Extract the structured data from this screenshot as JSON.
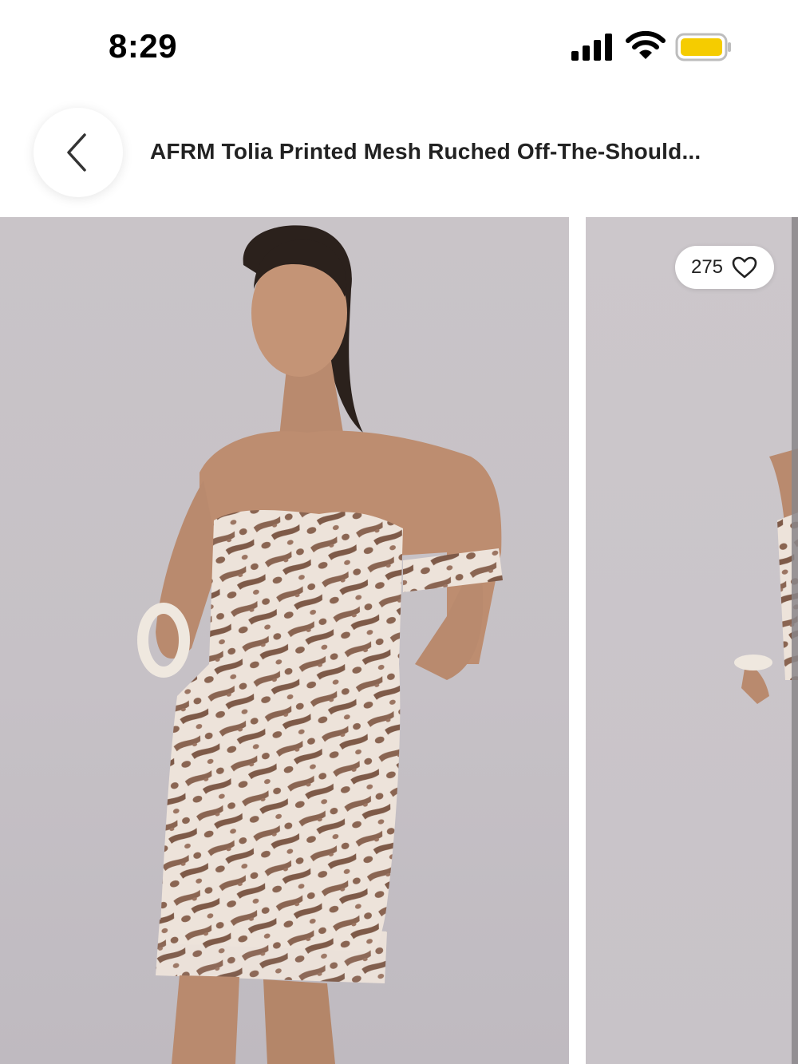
{
  "status_bar": {
    "time": "8:29",
    "icons": [
      "signal-icon",
      "wifi-icon",
      "battery-icon"
    ],
    "battery_color": "#F5CC00"
  },
  "header": {
    "back_icon": "chevron-left-icon",
    "title": "AFRM Tolia Printed Mesh Ruched Off-The-Should..."
  },
  "gallery": {
    "images": [
      "product-photo-front",
      "product-photo-side"
    ],
    "likes": {
      "count": "275",
      "icon": "heart-outline-icon"
    }
  },
  "colors": {
    "background": "#FFFFFF",
    "photo_backdrop": "#C7C2C7",
    "print_brown": "#8A6552",
    "print_cream": "#EFE6DD"
  }
}
